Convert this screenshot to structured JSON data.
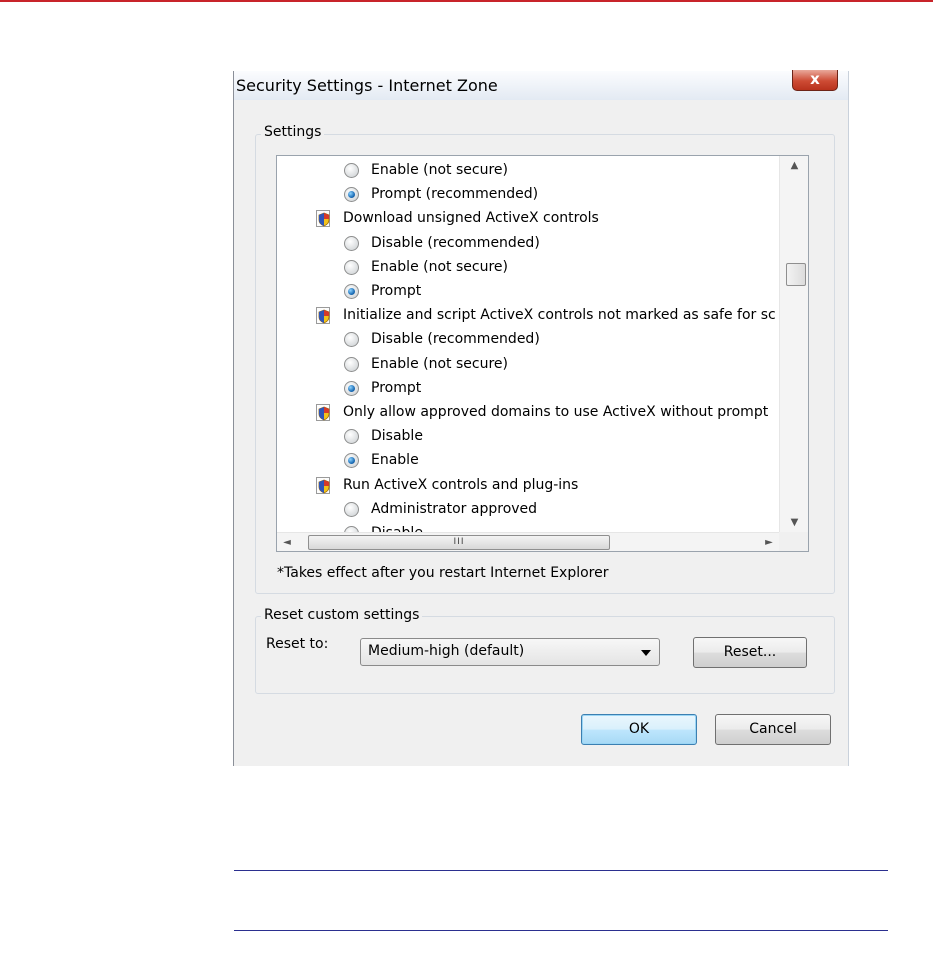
{
  "dialog": {
    "title": "Security Settings - Internet Zone",
    "close_label": "x"
  },
  "settings": {
    "group_label": "Settings",
    "items": [
      {
        "type": "option",
        "label": "Enable (not secure)",
        "checked": false
      },
      {
        "type": "option",
        "label": "Prompt (recommended)",
        "checked": true
      },
      {
        "type": "heading",
        "label": "Download unsigned ActiveX controls",
        "icon": "security-shield-icon"
      },
      {
        "type": "option",
        "label": "Disable (recommended)",
        "checked": false
      },
      {
        "type": "option",
        "label": "Enable (not secure)",
        "checked": false
      },
      {
        "type": "option",
        "label": "Prompt",
        "checked": true
      },
      {
        "type": "heading",
        "label": "Initialize and script ActiveX controls not marked as safe for sc",
        "icon": "security-shield-icon"
      },
      {
        "type": "option",
        "label": "Disable (recommended)",
        "checked": false
      },
      {
        "type": "option",
        "label": "Enable (not secure)",
        "checked": false
      },
      {
        "type": "option",
        "label": "Prompt",
        "checked": true
      },
      {
        "type": "heading",
        "label": "Only allow approved domains to use ActiveX without prompt",
        "icon": "security-shield-icon"
      },
      {
        "type": "option",
        "label": "Disable",
        "checked": false
      },
      {
        "type": "option",
        "label": "Enable",
        "checked": true
      },
      {
        "type": "heading",
        "label": "Run ActiveX controls and plug-ins",
        "icon": "security-shield-icon"
      },
      {
        "type": "option",
        "label": "Administrator approved",
        "checked": false
      },
      {
        "type": "option",
        "label": "Disable",
        "checked": false
      }
    ],
    "scrollbar": {
      "up_arrow": "▲",
      "down_arrow": "▼",
      "left_arrow": "◄",
      "right_arrow": "►",
      "hthumb_grip": "III"
    },
    "note": "*Takes effect after you restart Internet Explorer"
  },
  "reset": {
    "group_label": "Reset custom settings",
    "reset_to_label": "Reset to:",
    "selected_level": "Medium-high (default)",
    "reset_button": "Reset..."
  },
  "buttons": {
    "ok": "OK",
    "cancel": "Cancel"
  },
  "colors": {
    "top_rule": "#c8242a",
    "page_rule": "#2b2f8f",
    "close_button": "#cd4b34",
    "radio_checked": "#1e6fb8"
  }
}
